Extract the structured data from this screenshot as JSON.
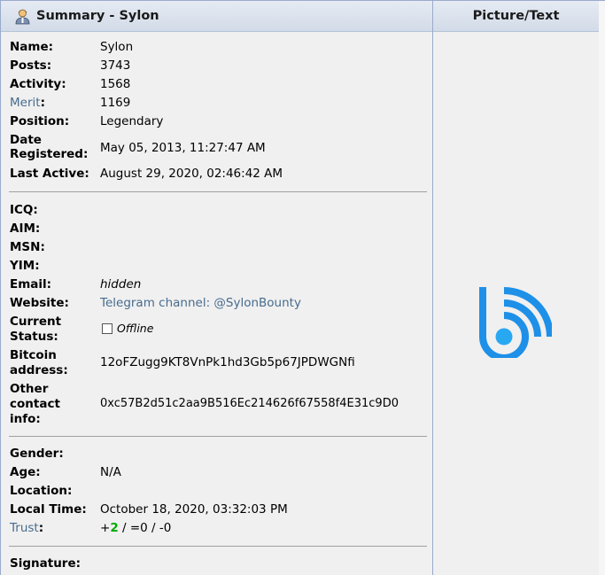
{
  "header": {
    "summary_title": "Summary - Sylon",
    "picture_title": "Picture/Text",
    "user_icon": "user-profile-icon"
  },
  "profile": {
    "name_label": "Name:",
    "name": "Sylon",
    "posts_label": "Posts:",
    "posts": "3743",
    "activity_label": "Activity:",
    "activity": "1568",
    "merit_label": "Merit",
    "merit_colon": ":",
    "merit": "1169",
    "position_label": "Position:",
    "position": "Legendary",
    "date_registered_label_1": "Date",
    "date_registered_label_2": "Registered:",
    "date_registered": "May 05, 2013, 11:27:47 AM",
    "last_active_label": "Last Active:",
    "last_active": "August 29, 2020, 02:46:42 AM"
  },
  "contact": {
    "icq_label": "ICQ:",
    "aim_label": "AIM:",
    "msn_label": "MSN:",
    "yim_label": "YIM:",
    "email_label": "Email:",
    "email": "hidden",
    "website_label": "Website:",
    "website": "Telegram channel: @SylonBounty",
    "status_label_1": "Current",
    "status_label_2": "Status:",
    "status": "Offline",
    "bitcoin_label_1": "Bitcoin",
    "bitcoin_label_2": "address:",
    "bitcoin": "12oFZugg9KT8VnPk1hd3Gb5p67JPDWGNfi",
    "other_label_1": "Other",
    "other_label_2": "contact",
    "other_label_3": "info:",
    "other": "0xc57B2d51c2aa9B516Ec214626f67558f4E31c9D0"
  },
  "personal": {
    "gender_label": "Gender:",
    "age_label": "Age:",
    "age": "N/A",
    "location_label": "Location:",
    "local_time_label": "Local Time:",
    "local_time": "October 18, 2020, 03:32:03 PM",
    "trust_label": "Trust",
    "trust_colon": ":",
    "trust_plus_sign": "+",
    "trust_plus": "2",
    "trust_rest": " / =0 / -0",
    "signature_label": "Signature:"
  },
  "colors": {
    "link": "#476c8e",
    "trust_positive": "#00aa00",
    "logo_blue": "#1e90e8"
  },
  "avatar_icon": "bounty-b-logo-icon"
}
